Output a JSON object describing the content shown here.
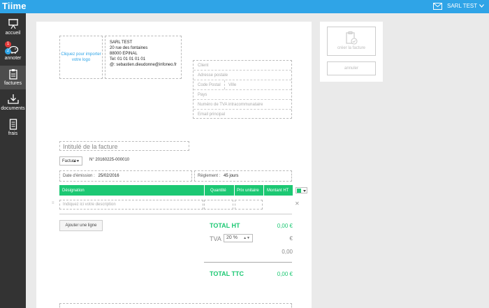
{
  "topbar": {
    "brand": "Tiime",
    "company": "SARL TEST"
  },
  "sidebar": {
    "items": [
      {
        "label": "accueil",
        "icon": "presentation-icon"
      },
      {
        "label": "annoter",
        "icon": "piggy-bank-icon",
        "badges": [
          "1",
          "2"
        ]
      },
      {
        "label": "factures",
        "icon": "clipboard-icon"
      },
      {
        "label": "documents",
        "icon": "inbox-download-icon"
      },
      {
        "label": "frais",
        "icon": "receipt-icon"
      }
    ]
  },
  "invoice": {
    "logo_prompt": "Cliquez pour importer votre logo",
    "company": {
      "name": "SARL TEST",
      "address": "20 rue des fontaines",
      "city": "88000 EPINAL",
      "phone": "Tel: 01 01 01 01 01",
      "email": "@: sebastien.dieudonne@infoneo.fr"
    },
    "client_placeholders": {
      "client": "Client",
      "address": "Adresse postale",
      "postal": "Code Postal",
      "city": "Ville",
      "country": "Pays",
      "vat": "Numéro de TVA intracommunataire",
      "email": "Email principal"
    },
    "title_placeholder": "Intitulé de la facture",
    "type": "Facture",
    "number": "N° 20160225-000010",
    "date_label": "Date d'émission :",
    "date_value": "25/02/2016",
    "payment_label": "Règlement :",
    "payment_value": "45 jours",
    "table": {
      "headers": [
        "Désignation",
        "Quantité",
        "Prix unitaire",
        "Montant HT"
      ],
      "description_placeholder": "Indiquez ici votre description"
    },
    "add_line": "Ajouter une ligne",
    "totals": {
      "ht_label": "TOTAL HT",
      "ht_value": "0,00 €",
      "tva_label": "TVA",
      "tva_rate": "20 %",
      "tva_currency": "€",
      "tva_value": "0,00",
      "ttc_label": "TOTAL TTC",
      "ttc_value": "0,00 €"
    },
    "accent_color": "#1cc873"
  },
  "actions": {
    "create": "créer la facture",
    "cancel": "annuler"
  },
  "colors": {
    "topbar": "#2fa4e7",
    "sidebar": "#333333",
    "accent": "#1cc873"
  }
}
